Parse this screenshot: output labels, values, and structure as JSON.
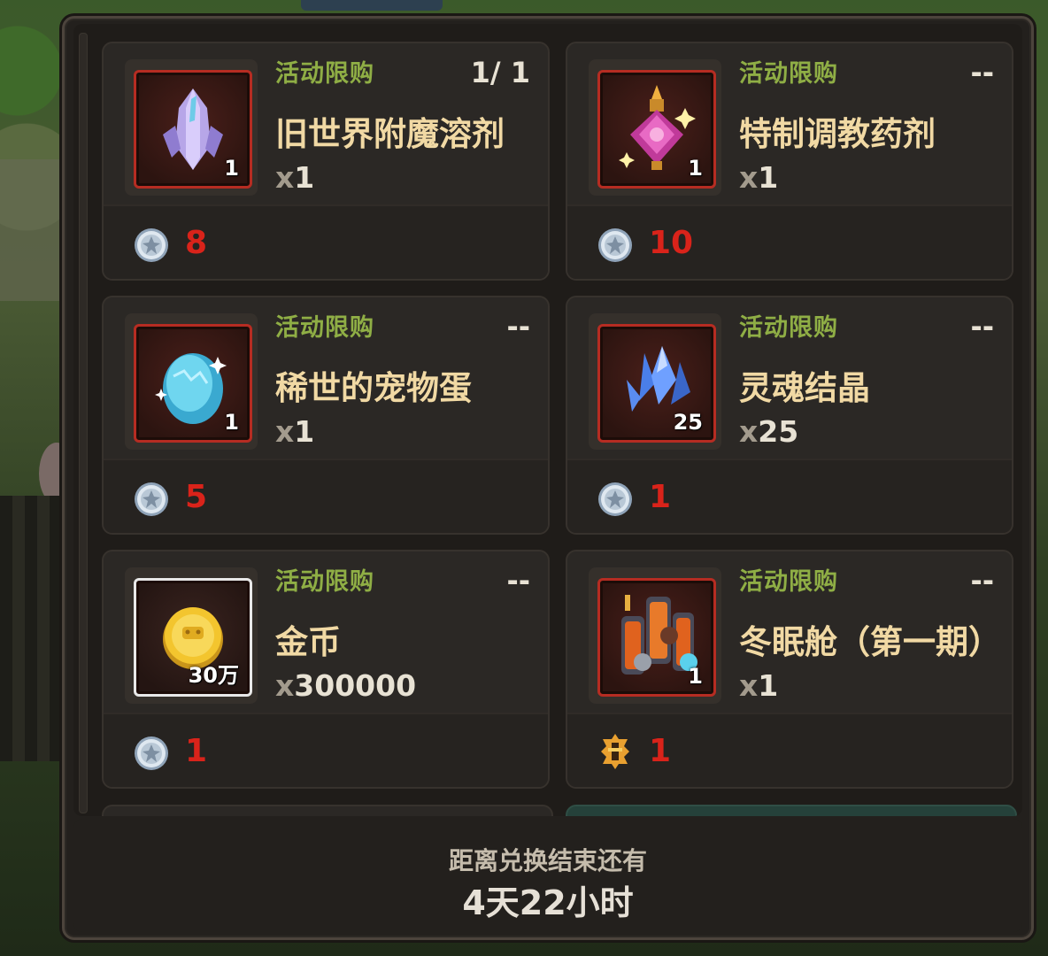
{
  "items": [
    {
      "tag": "活动限购",
      "limit": "1/ 1",
      "name": "旧世界附魔溶剂",
      "qty_prefix": "x",
      "qty": "1",
      "count": "1",
      "price": "8",
      "icon": "enchant-crystal-icon",
      "currency": "silver-coin-icon"
    },
    {
      "tag": "活动限购",
      "limit": "--",
      "name": "特制调教药剂",
      "qty_prefix": "x",
      "qty": "1",
      "count": "1",
      "price": "10",
      "icon": "potion-icon",
      "currency": "silver-coin-icon"
    },
    {
      "tag": "活动限购",
      "limit": "--",
      "name": "稀世的宠物蛋",
      "qty_prefix": "x",
      "qty": "1",
      "count": "1",
      "price": "5",
      "icon": "pet-egg-icon",
      "currency": "silver-coin-icon"
    },
    {
      "tag": "活动限购",
      "limit": "--",
      "name": "灵魂结晶",
      "qty_prefix": "x",
      "qty": "25",
      "count": "25",
      "price": "1",
      "icon": "soul-crystal-icon",
      "currency": "silver-coin-icon"
    },
    {
      "tag": "活动限购",
      "limit": "--",
      "name": "金币",
      "qty_prefix": "x",
      "qty": "300000",
      "count": "30万",
      "price": "1",
      "icon": "gold-coin-icon",
      "currency": "silver-coin-icon"
    },
    {
      "tag": "活动限购",
      "limit": "--",
      "name": "冬眠舱（第一期）",
      "qty_prefix": "x",
      "qty": "1",
      "count": "1",
      "price": "1",
      "icon": "hibernation-pod-icon",
      "currency": "gold-emblem-icon"
    }
  ],
  "footer": {
    "label": "距离兑换结束还有",
    "time": "4天22小时"
  },
  "colors": {
    "tag": "#8fae45",
    "price": "#d9231a",
    "name": "#f1d9a4",
    "icon_border": "#b62c22"
  }
}
